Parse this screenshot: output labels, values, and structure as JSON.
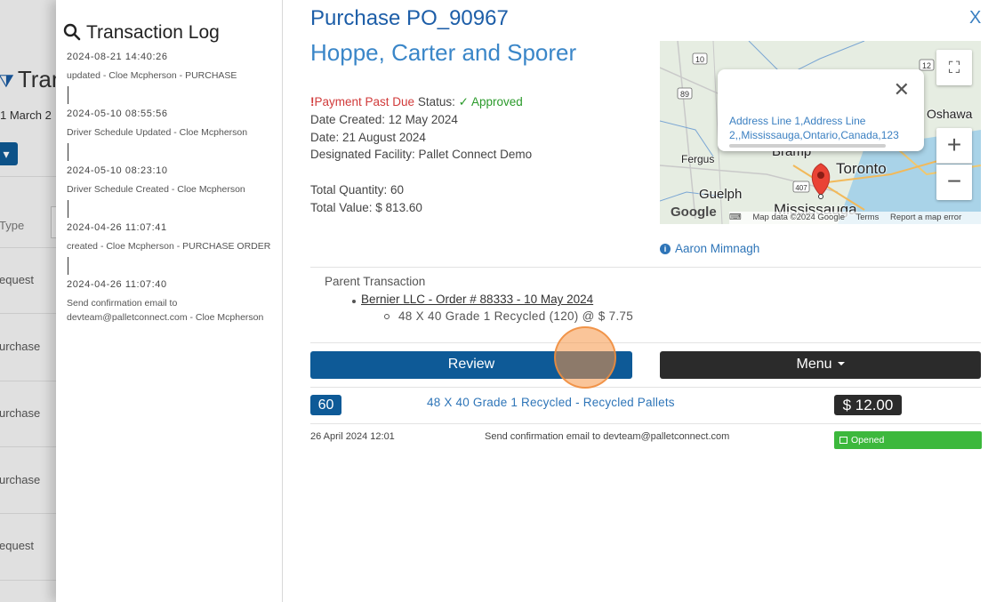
{
  "background": {
    "title": "Tran",
    "date": "1 March 2",
    "type_label": "Type",
    "rows": [
      "equest",
      "urchase",
      "urchase",
      "urchase",
      "equest"
    ]
  },
  "sidebar": {
    "title": "Transaction Log",
    "entries": [
      {
        "date": "2024-08-21 14:40:26",
        "text": "updated - Cloe Mcpherson - PURCHASE"
      },
      {
        "date": "2024-05-10 08:55:56",
        "text": "Driver Schedule Updated - Cloe Mcpherson"
      },
      {
        "date": "2024-05-10 08:23:10",
        "text": "Driver Schedule Created - Cloe Mcpherson"
      },
      {
        "date": "2024-04-26 11:07:41",
        "text": "created - Cloe Mcpherson - PURCHASE ORDER"
      },
      {
        "date": "2024-04-26 11:07:40",
        "text": "Send confirmation email to devteam@palletconnect.com - Cloe Mcpherson"
      }
    ]
  },
  "header": {
    "title": "Purchase PO_90967",
    "company": "Hoppe, Carter and Sporer",
    "close_label": "X"
  },
  "details": {
    "past_due_mark": "!",
    "past_due": "Payment Past Due",
    "status_label": "Status:",
    "status_check": "✓",
    "status_value": "Approved",
    "date_created": "Date Created: 12 May 2024",
    "date": "Date: 21 August 2024",
    "facility": "Designated Facility: Pallet Connect Demo",
    "total_quantity": "Total Quantity: 60",
    "total_value": "Total Value: $ 813.60"
  },
  "map": {
    "popup_address": "Address Line 1,Address Line 2,,Mississauga,Ontario,Canada,123",
    "labels": {
      "oshawa": "Oshawa",
      "toronto": "Toronto",
      "fergus": "Fergus",
      "guelph": "Guelph",
      "mississauga": "Mississauga",
      "bramp": "Bramp"
    },
    "highways": [
      "10",
      "89",
      "12",
      "407"
    ],
    "logo": "Google",
    "attribution": [
      "Map data ©2024 Google",
      "Terms",
      "Report a map error"
    ]
  },
  "contact": {
    "icon": "i",
    "name": "Aaron Mimnagh"
  },
  "parent": {
    "label": "Parent Transaction",
    "order": "Bernier LLC - Order # 88333 - 10 May 2024",
    "item": "48 X 40 Grade 1 Recycled (120) @ $ 7.75"
  },
  "actions": {
    "review": "Review",
    "menu": "Menu"
  },
  "line_item": {
    "quantity": "60",
    "description": "48 X 40 Grade 1 Recycled - Recycled Pallets",
    "price": "$ 12.00"
  },
  "email_log": {
    "date": "26 April 2024 12:01",
    "text": "Send confirmation email to devteam@palletconnect.com",
    "status": "Opened"
  }
}
